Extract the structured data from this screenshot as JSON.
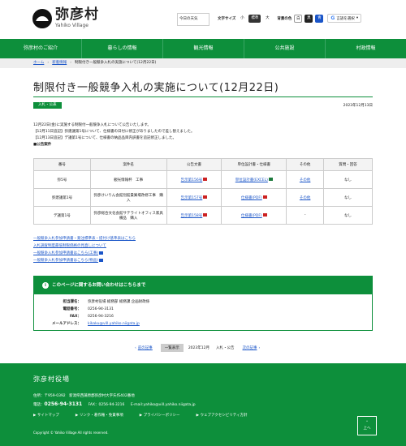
{
  "header": {
    "logo_text": "弥彦村",
    "logo_sub": "Yahiko Village",
    "today_label": "今日の天気",
    "font_size_label": "文字サイズ",
    "font_size_options": [
      "小",
      "標準",
      "大"
    ],
    "bg_color_label": "背景の色",
    "bg_color_options": [
      "白",
      "黒",
      "青"
    ],
    "language_label": "言語を選択",
    "google_icon": "G"
  },
  "nav": {
    "items": [
      "弥彦村のご紹介",
      "暮らしの情報",
      "観光情報",
      "公共施設",
      "村政情報"
    ]
  },
  "breadcrumb": [
    "ホーム",
    "新着情報",
    "制限付き一般競争入札の実施について(12月22日)"
  ],
  "page": {
    "title": "制限付き一般競争入札の実施について(12月22日)",
    "category": "入札・公表",
    "date": "2023年12月13日",
    "body": [
      "12月22日(金)に実施する制限付一般競争入札について公告いたします。",
      "【12月11日追記】弥建議第1号について、仕様書の日付に修正がありましたので差し替えました。",
      "【12月13日追記】デ議第1号について、仕様書の納品品目内訳書を追記修正しました。",
      "■公告案件"
    ]
  },
  "table": {
    "headers": [
      "番号",
      "案件名",
      "公告文書",
      "単位設計書・仕様書",
      "その他",
      "質問・回答"
    ],
    "rows": [
      [
        "弥5号",
        "観光情報杯　工事",
        "告示第156号",
        "単位設計書(EXCEL)",
        "その他",
        "なし"
      ],
      [
        "弥建議第1号",
        "弥彦けいりん会館別館貴賓場改修工事　購入",
        "告示第157号",
        "仕様書(PDF)",
        "その他",
        "なし"
      ],
      [
        "デ議第1号",
        "弥彦総合文化会館サテライトオフィス家具備品　購入",
        "告示第158号",
        "仕様書(PDF)",
        "-",
        "なし"
      ]
    ]
  },
  "links": [
    "一般競争入札参加申請書・発注標準表・提付け基準表はこちら",
    "入札調査制度最低制限価格の見直しについて",
    "一般競争入札参加申請書はこちら(工事)",
    "一般競争入札参加申請書はこちら(物品)"
  ],
  "inquiry": {
    "heading": "このページに関するお問い合わせはこちらまで",
    "rows": [
      {
        "label": "担当課名：",
        "value": "弥彦村役場 総務部 総務課 企画財政係"
      },
      {
        "label": "電話番号：",
        "value": "0256-94-3131"
      },
      {
        "label": "FAX：",
        "value": "0256-94-3216"
      },
      {
        "label": "メールアドレス：",
        "value": "kikaku@vill.yahiko.niigata.jp"
      }
    ]
  },
  "pager": {
    "prev": "前の記事",
    "list": "一覧表示",
    "month": "2023年12月",
    "category": "入札・公告",
    "next": "次の記事"
  },
  "footer": {
    "name": "弥彦村役場",
    "address": "住所：〒959-0392　新潟県西蒲原郡弥彦村大字矢作402番地",
    "tel_label": "電話：",
    "tel": "0256-94-3131",
    "fax": "FAX：0256-94-3216",
    "email": "E-mail:yahiko@vill.yahiko.niigata.jp",
    "links": [
      "サイトマップ",
      "リンク・著作権・免責事項",
      "プライバシーポリシー",
      "ウェブアクセシビリティ方針"
    ],
    "copyright": "Copyright © Yahiko Village All rights reserved.",
    "totop": "上へ"
  },
  "colors": {
    "accent": "#0d8f3b",
    "link": "#1a55c8"
  }
}
